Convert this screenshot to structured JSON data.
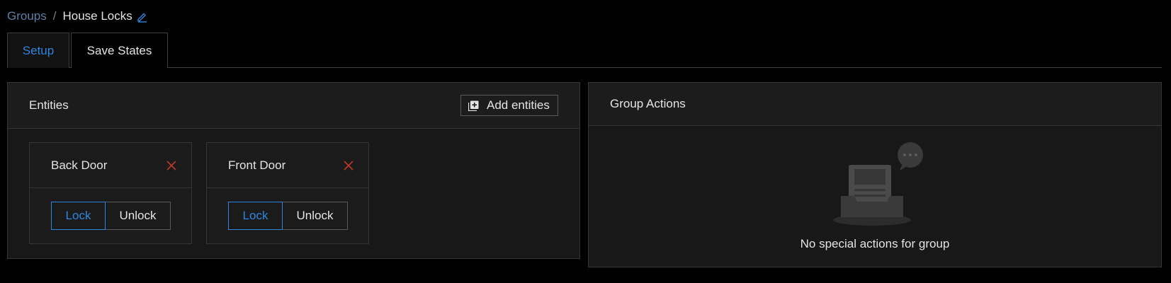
{
  "breadcrumb": {
    "parent": "Groups",
    "separator": "/",
    "current": "House Locks"
  },
  "tabs": [
    {
      "label": "Setup",
      "active": true
    },
    {
      "label": "Save States",
      "active": false
    }
  ],
  "entities_panel": {
    "title": "Entities",
    "add_button_label": "Add entities",
    "items": [
      {
        "name": "Back Door",
        "actions": [
          "Lock",
          "Unlock"
        ],
        "selected": "Lock"
      },
      {
        "name": "Front Door",
        "actions": [
          "Lock",
          "Unlock"
        ],
        "selected": "Lock"
      }
    ]
  },
  "group_actions_panel": {
    "title": "Group Actions",
    "empty_message": "No special actions for group"
  },
  "colors": {
    "accent": "#2e86de",
    "remove": "#c0392b",
    "background": "#000000",
    "panel": "#181818"
  },
  "icons": {
    "edit": "pencil-icon",
    "add": "add-box-icon",
    "remove": "close-icon",
    "empty": "empty-inbox-illustration"
  }
}
